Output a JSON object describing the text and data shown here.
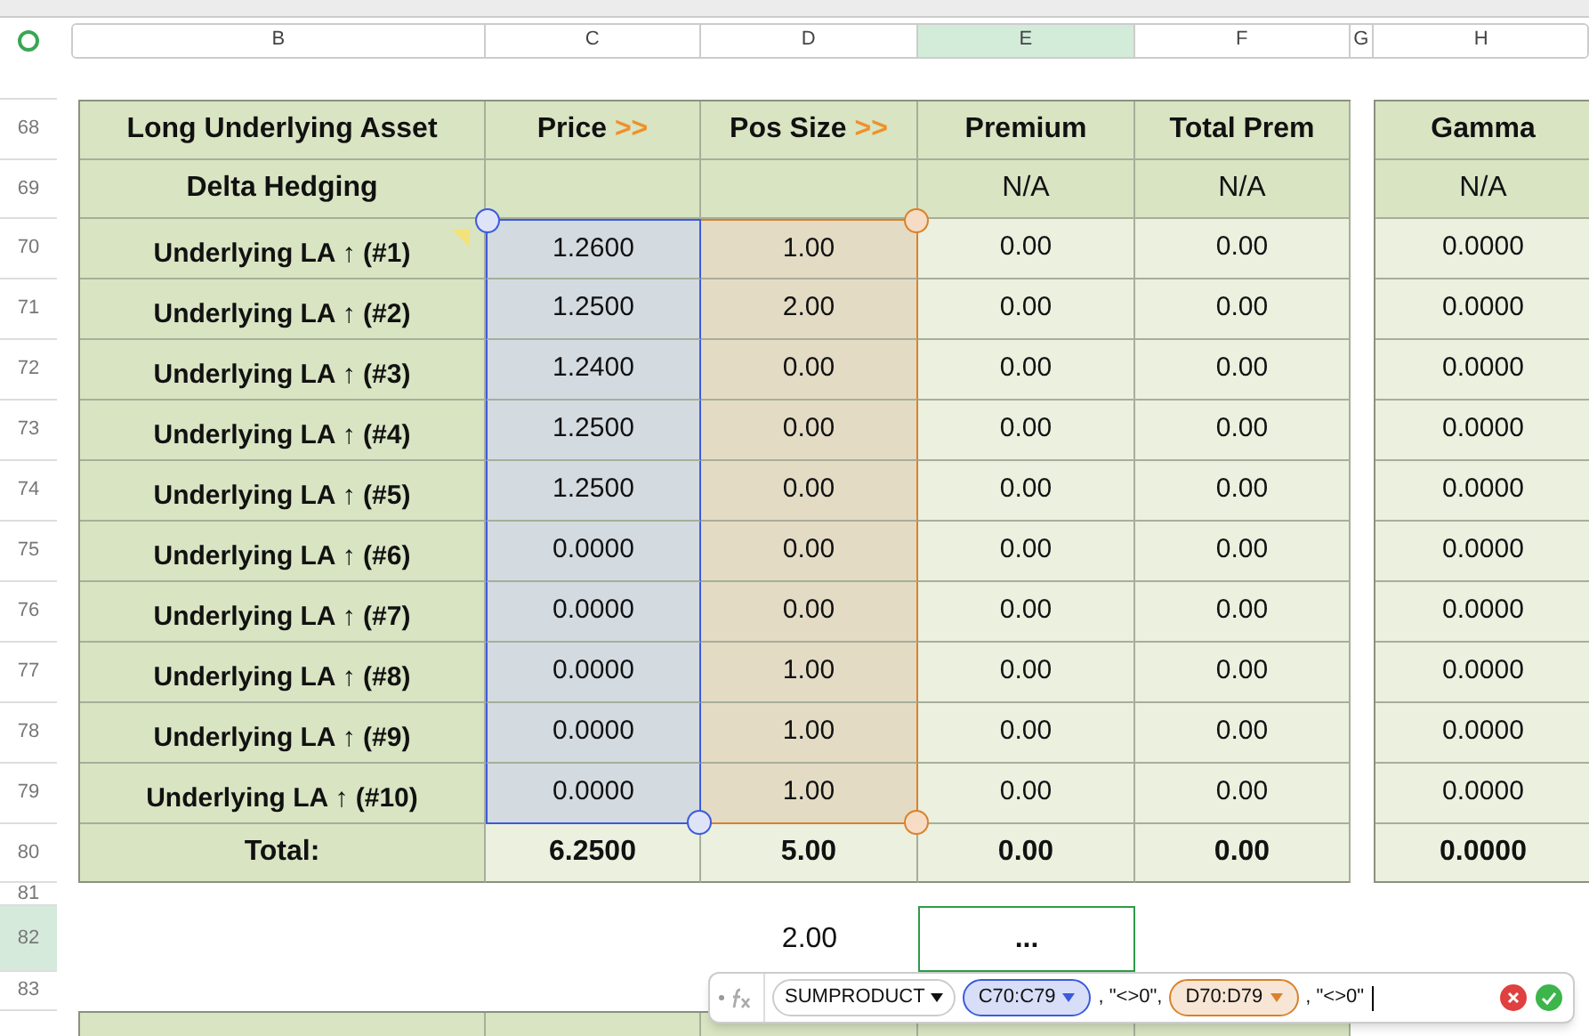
{
  "column_headers": [
    {
      "label": "B",
      "selected": false
    },
    {
      "label": "C",
      "selected": false
    },
    {
      "label": "D",
      "selected": false
    },
    {
      "label": "E",
      "selected": true
    },
    {
      "label": "F",
      "selected": false
    },
    {
      "label": "G",
      "selected": false
    },
    {
      "label": "H",
      "selected": false
    }
  ],
  "header_rows": [
    {
      "number": "68",
      "label": "Long Underlying Asset",
      "cells": [
        {
          "text": "Price",
          "suffix": ">>"
        },
        {
          "text": "Pos Size",
          "suffix": ">>"
        },
        {
          "text": "Premium"
        },
        {
          "text": "Total Prem"
        }
      ],
      "gamma": "Gamma"
    },
    {
      "number": "69",
      "label": "Delta Hedging",
      "cells": [
        {
          "text": ""
        },
        {
          "text": ""
        },
        {
          "text": "N/A"
        },
        {
          "text": "N/A"
        }
      ],
      "gamma": "N/A"
    }
  ],
  "data_rows": [
    {
      "number": "70",
      "label": "Underlying LA ↑ (#1)",
      "comment": true,
      "price": "1.2600",
      "size": "1.00",
      "premium": "0.00",
      "total": "0.00",
      "gamma": "0.0000"
    },
    {
      "number": "71",
      "label": "Underlying LA ↑ (#2)",
      "comment": false,
      "price": "1.2500",
      "size": "2.00",
      "premium": "0.00",
      "total": "0.00",
      "gamma": "0.0000"
    },
    {
      "number": "72",
      "label": "Underlying LA ↑ (#3)",
      "comment": false,
      "price": "1.2400",
      "size": "0.00",
      "premium": "0.00",
      "total": "0.00",
      "gamma": "0.0000"
    },
    {
      "number": "73",
      "label": "Underlying LA ↑ (#4)",
      "comment": false,
      "price": "1.2500",
      "size": "0.00",
      "premium": "0.00",
      "total": "0.00",
      "gamma": "0.0000"
    },
    {
      "number": "74",
      "label": "Underlying LA ↑ (#5)",
      "comment": false,
      "price": "1.2500",
      "size": "0.00",
      "premium": "0.00",
      "total": "0.00",
      "gamma": "0.0000"
    },
    {
      "number": "75",
      "label": "Underlying LA ↑ (#6)",
      "comment": false,
      "price": "0.0000",
      "size": "0.00",
      "premium": "0.00",
      "total": "0.00",
      "gamma": "0.0000"
    },
    {
      "number": "76",
      "label": "Underlying LA ↑ (#7)",
      "comment": false,
      "price": "0.0000",
      "size": "0.00",
      "premium": "0.00",
      "total": "0.00",
      "gamma": "0.0000"
    },
    {
      "number": "77",
      "label": "Underlying LA ↑ (#8)",
      "comment": false,
      "price": "0.0000",
      "size": "1.00",
      "premium": "0.00",
      "total": "0.00",
      "gamma": "0.0000"
    },
    {
      "number": "78",
      "label": "Underlying LA ↑ (#9)",
      "comment": false,
      "price": "0.0000",
      "size": "1.00",
      "premium": "0.00",
      "total": "0.00",
      "gamma": "0.0000"
    },
    {
      "number": "79",
      "label": "Underlying LA ↑ (#10)",
      "comment": false,
      "price": "0.0000",
      "size": "1.00",
      "premium": "0.00",
      "total": "0.00",
      "gamma": "0.0000"
    }
  ],
  "total_row": {
    "number": "80",
    "label": "Total:",
    "price": "6.2500",
    "size": "5.00",
    "premium": "0.00",
    "total": "0.00",
    "gamma": "0.0000"
  },
  "spacer_row": {
    "number": "81"
  },
  "result_row": {
    "number": "82",
    "selected": true,
    "size": "2.00",
    "premium": "...",
    "premium_selected": true
  },
  "empty_row": {
    "number": "83"
  },
  "formula_bar": {
    "function": "SUMPRODUCT",
    "parts": [
      {
        "kind": "range",
        "text": "C70:C79",
        "color": "#3b5bdb"
      },
      {
        "kind": "text",
        "text": ", \"<>0\","
      },
      {
        "kind": "range",
        "text": "D70:D79",
        "color": "#d9822b"
      },
      {
        "kind": "text",
        "text": ", \"<>0\""
      }
    ]
  }
}
